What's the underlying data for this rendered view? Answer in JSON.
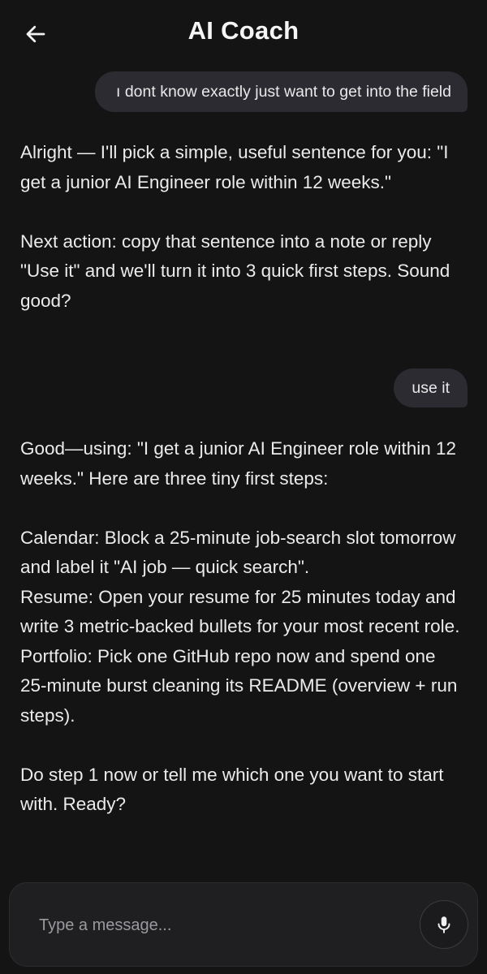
{
  "header": {
    "title": "AI Coach",
    "back_icon": "arrow-left-icon"
  },
  "messages": [
    {
      "role": "user",
      "text": "ı dont know exactly just want to get into the field"
    },
    {
      "role": "assistant",
      "paragraphs": [
        "Alright — I'll pick a simple, useful sentence for you: \"I get a junior AI Engineer role within 12 weeks.\"",
        "Next action: copy that sentence into a note or reply \"Use it\" and we'll turn it into 3 quick first steps. Sound good?"
      ]
    },
    {
      "role": "user",
      "text": "use it"
    },
    {
      "role": "assistant",
      "paragraphs": [
        "Good—using: \"I get a junior AI Engineer role within 12 weeks.\" Here are three tiny first steps:",
        "Calendar: Block a 25-minute job-search slot tomorrow and label it \"AI job — quick search\".",
        "Resume: Open your resume for 25 minutes today and write 3 metric-backed bullets for your most recent role.",
        "Portfolio: Pick one GitHub repo now and spend one 25-minute burst cleaning its README (overview + run steps).",
        "Do step 1 now or tell me which one you want to start with. Ready?"
      ]
    }
  ],
  "composer": {
    "placeholder": "Type a message...",
    "value": "",
    "mic_icon": "microphone-icon"
  },
  "colors": {
    "background": "#141414",
    "user_bubble": "#2b2b31",
    "text": "#ebebeb",
    "placeholder": "#9a9a9e"
  }
}
